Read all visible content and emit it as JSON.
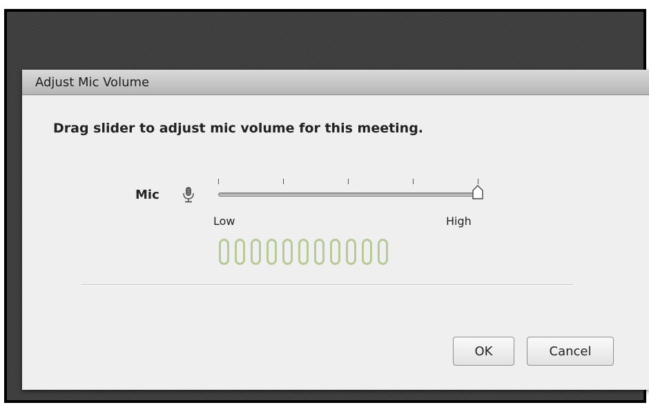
{
  "dialog": {
    "title": "Adjust Mic Volume",
    "instruction": "Drag slider to adjust mic volume for this meeting.",
    "mic_label": "Mic",
    "slider": {
      "value": 1.0,
      "tick_count": 5,
      "low_label": "Low",
      "high_label": "High"
    },
    "meter": {
      "segment_count": 11,
      "active_segments": 0,
      "segment_color": "#b6c999"
    },
    "buttons": {
      "ok_label": "OK",
      "cancel_label": "Cancel"
    }
  }
}
